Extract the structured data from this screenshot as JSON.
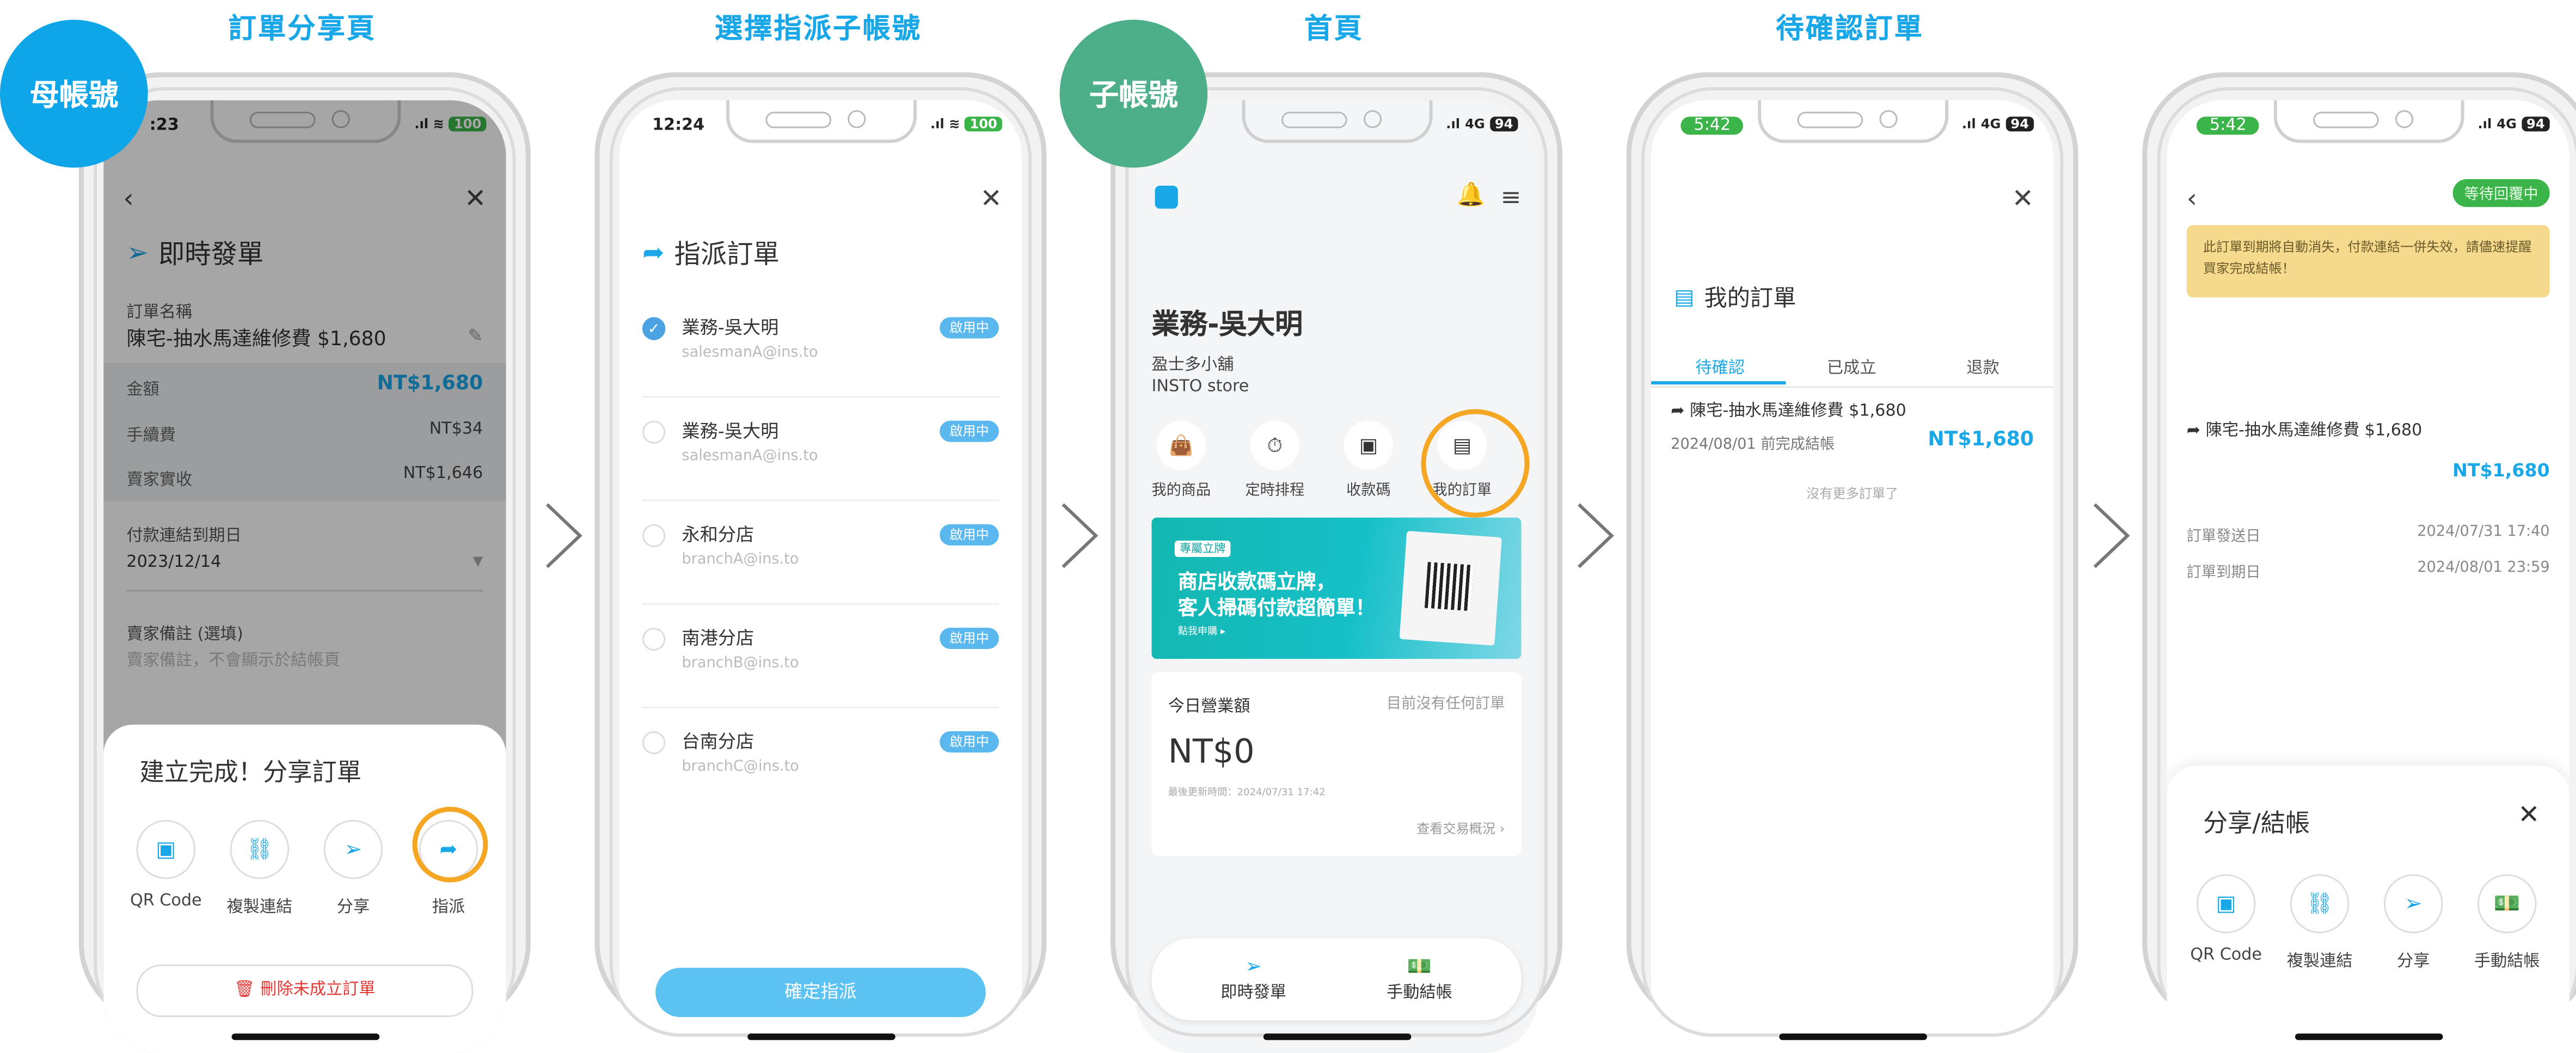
{
  "section_titles": [
    "訂單分享頁",
    "選擇指派子帳號",
    "首頁",
    "待確認訂單"
  ],
  "badges": {
    "parent": "母帳號",
    "child": "子帳號"
  },
  "colors": {
    "accent": "#1aa7e8",
    "highlight_ring": "#f5a623",
    "status_green": "#3bb54a",
    "delete_red": "#e53935"
  },
  "screen1": {
    "status_time": ":23",
    "battery": "100",
    "title": "即時發單",
    "order_name_label": "訂單名稱",
    "order_name_value": "陳宅-抽水馬達維修費 $1,680",
    "amount_label": "金額",
    "amount_value": "NT$1,680",
    "fee_label": "手續費",
    "fee_value": "NT$34",
    "seller_label": "賣家實收",
    "seller_value": "NT$1,646",
    "deadline_label": "付款連結到期日",
    "deadline_value": "2023/12/14",
    "note_label": "賣家備註 (選填)",
    "note_placeholder": "賣家備註，不會顯示於結帳頁",
    "sheet_title": "建立完成！分享訂單",
    "share_items": [
      "QR Code",
      "複製連結",
      "分享",
      "指派"
    ],
    "delete_button": "刪除未成立訂單"
  },
  "screen2": {
    "status_time": "12:24",
    "battery": "100",
    "title": "指派訂單",
    "accounts": [
      {
        "name": "業務-吳大明",
        "email": "salesmanA@ins.to",
        "tag": "啟用中",
        "selected": true
      },
      {
        "name": "業務-吳大明",
        "email": "salesmanA@ins.to",
        "tag": "啟用中",
        "selected": false
      },
      {
        "name": "永和分店",
        "email": "branchA@ins.to",
        "tag": "啟用中",
        "selected": false
      },
      {
        "name": "南港分店",
        "email": "branchB@ins.to",
        "tag": "啟用中",
        "selected": false
      },
      {
        "name": "台南分店",
        "email": "branchC@ins.to",
        "tag": "啟用中",
        "selected": false
      }
    ],
    "confirm_button": "確定指派"
  },
  "screen3": {
    "network": "4G",
    "battery": "94",
    "business_name": "業務-吳大明",
    "shop_name": "盈士多小舖",
    "store_name": "INSTO store",
    "quick_actions": [
      "我的商品",
      "定時排程",
      "收款碼",
      "我的訂單"
    ],
    "banner": {
      "tag": "專屬立牌",
      "line1": "商店收款碼立牌，",
      "line2": "客人掃碼付款超簡單！",
      "cta": "點我申購 ▸"
    },
    "today_label": "今日營業額",
    "today_hint": "目前沒有任何訂單",
    "today_amount": "NT$0",
    "updated": "最後更新時間：2024/07/31 17:42",
    "view_link": "查看交易概況 ›",
    "nav": [
      "即時發單",
      "手動結帳"
    ]
  },
  "screen4": {
    "status_time": "5:42",
    "network": "4G",
    "battery": "94",
    "title": "我的訂單",
    "tabs": [
      "待確認",
      "已成立",
      "退款"
    ],
    "order_name": "陳宅-抽水馬達維修費 $1,680",
    "order_deadline": "2024/08/01 前完成結帳",
    "order_amount": "NT$1,680",
    "no_more": "沒有更多訂單了"
  },
  "screen5": {
    "status_time": "5:42",
    "network": "4G",
    "battery": "94",
    "status_badge": "等待回覆中",
    "notice": "此訂單到期將自動消失，付款連結一併失效，請儘速提醒買家完成結帳！",
    "order_name": "陳宅-抽水馬達維修費 $1,680",
    "amount": "NT$1,680",
    "sent_label": "訂單發送日",
    "sent_value": "2024/07/31 17:40",
    "expire_label": "訂單到期日",
    "expire_value": "2024/08/01 23:59",
    "sheet_title": "分享/結帳",
    "share_items": [
      "QR Code",
      "複製連結",
      "分享",
      "手動結帳"
    ]
  }
}
